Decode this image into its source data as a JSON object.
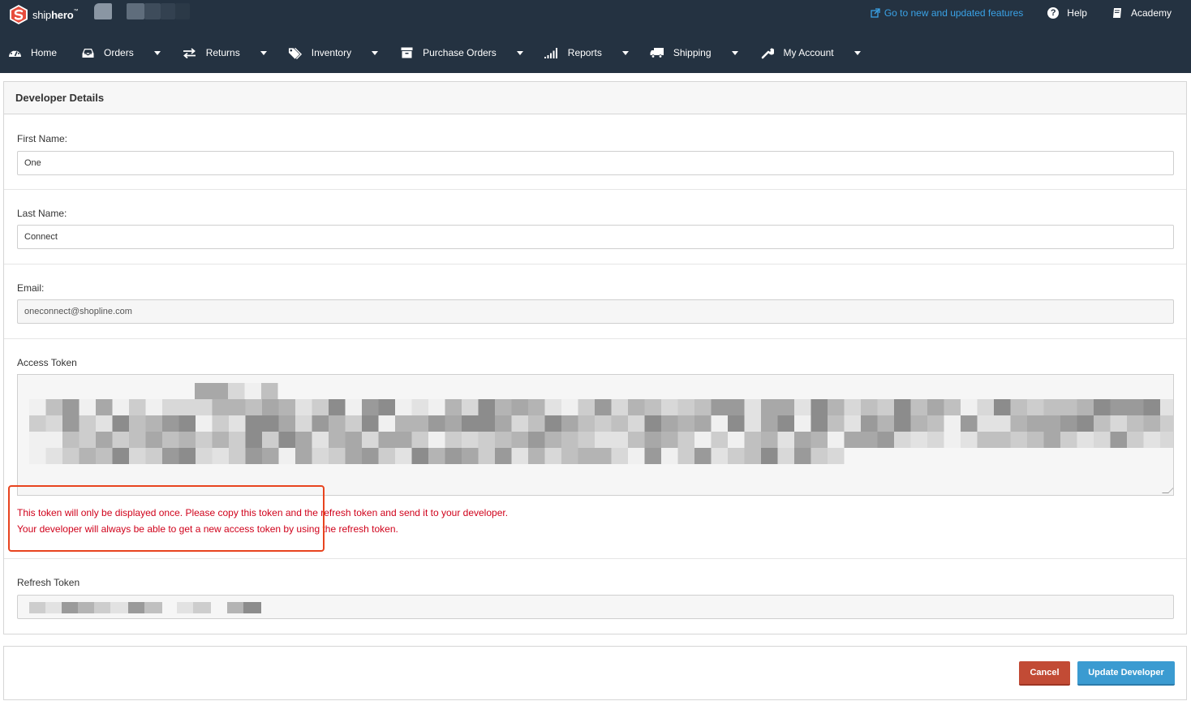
{
  "brand": {
    "name_light": "ship",
    "name_bold": "hero",
    "tm": "™"
  },
  "topbar": {
    "features_link": "Go to new and updated features",
    "help": "Help",
    "academy": "Academy"
  },
  "nav": [
    {
      "label": "Home",
      "icon": "dashboard-icon",
      "dropdown": false
    },
    {
      "label": "Orders",
      "icon": "inbox-icon",
      "dropdown": true
    },
    {
      "label": "Returns",
      "icon": "exchange-icon",
      "dropdown": true
    },
    {
      "label": "Inventory",
      "icon": "tags-icon",
      "dropdown": true
    },
    {
      "label": "Purchase Orders",
      "icon": "archive-icon",
      "dropdown": true
    },
    {
      "label": "Reports",
      "icon": "signal-icon",
      "dropdown": true
    },
    {
      "label": "Shipping",
      "icon": "truck-icon",
      "dropdown": true
    },
    {
      "label": "My Account",
      "icon": "wrench-icon",
      "dropdown": true
    }
  ],
  "panel": {
    "title": "Developer Details",
    "first_name": {
      "label": "First Name:",
      "value": "One"
    },
    "last_name": {
      "label": "Last Name:",
      "value": "Connect"
    },
    "email": {
      "label": "Email:",
      "value": "oneconnect@shopline.com"
    },
    "access_token": {
      "label": "Access Token"
    },
    "warning_line1": "This token will only be displayed once. Please copy this token and the refresh token and send it to your developer.",
    "warning_line2": "Your developer will always be able to get a new access token by using the refresh token.",
    "refresh_token": {
      "label": "Refresh Token"
    }
  },
  "footer": {
    "cancel": "Cancel",
    "update": "Update Developer"
  },
  "colors": {
    "topbar_bg": "#243241",
    "link_blue": "#3aa2e6",
    "warning_red": "#d0021b",
    "cancel_bg": "#c24b35",
    "update_bg": "#3b9bd1",
    "highlight_border": "#e8441f"
  }
}
